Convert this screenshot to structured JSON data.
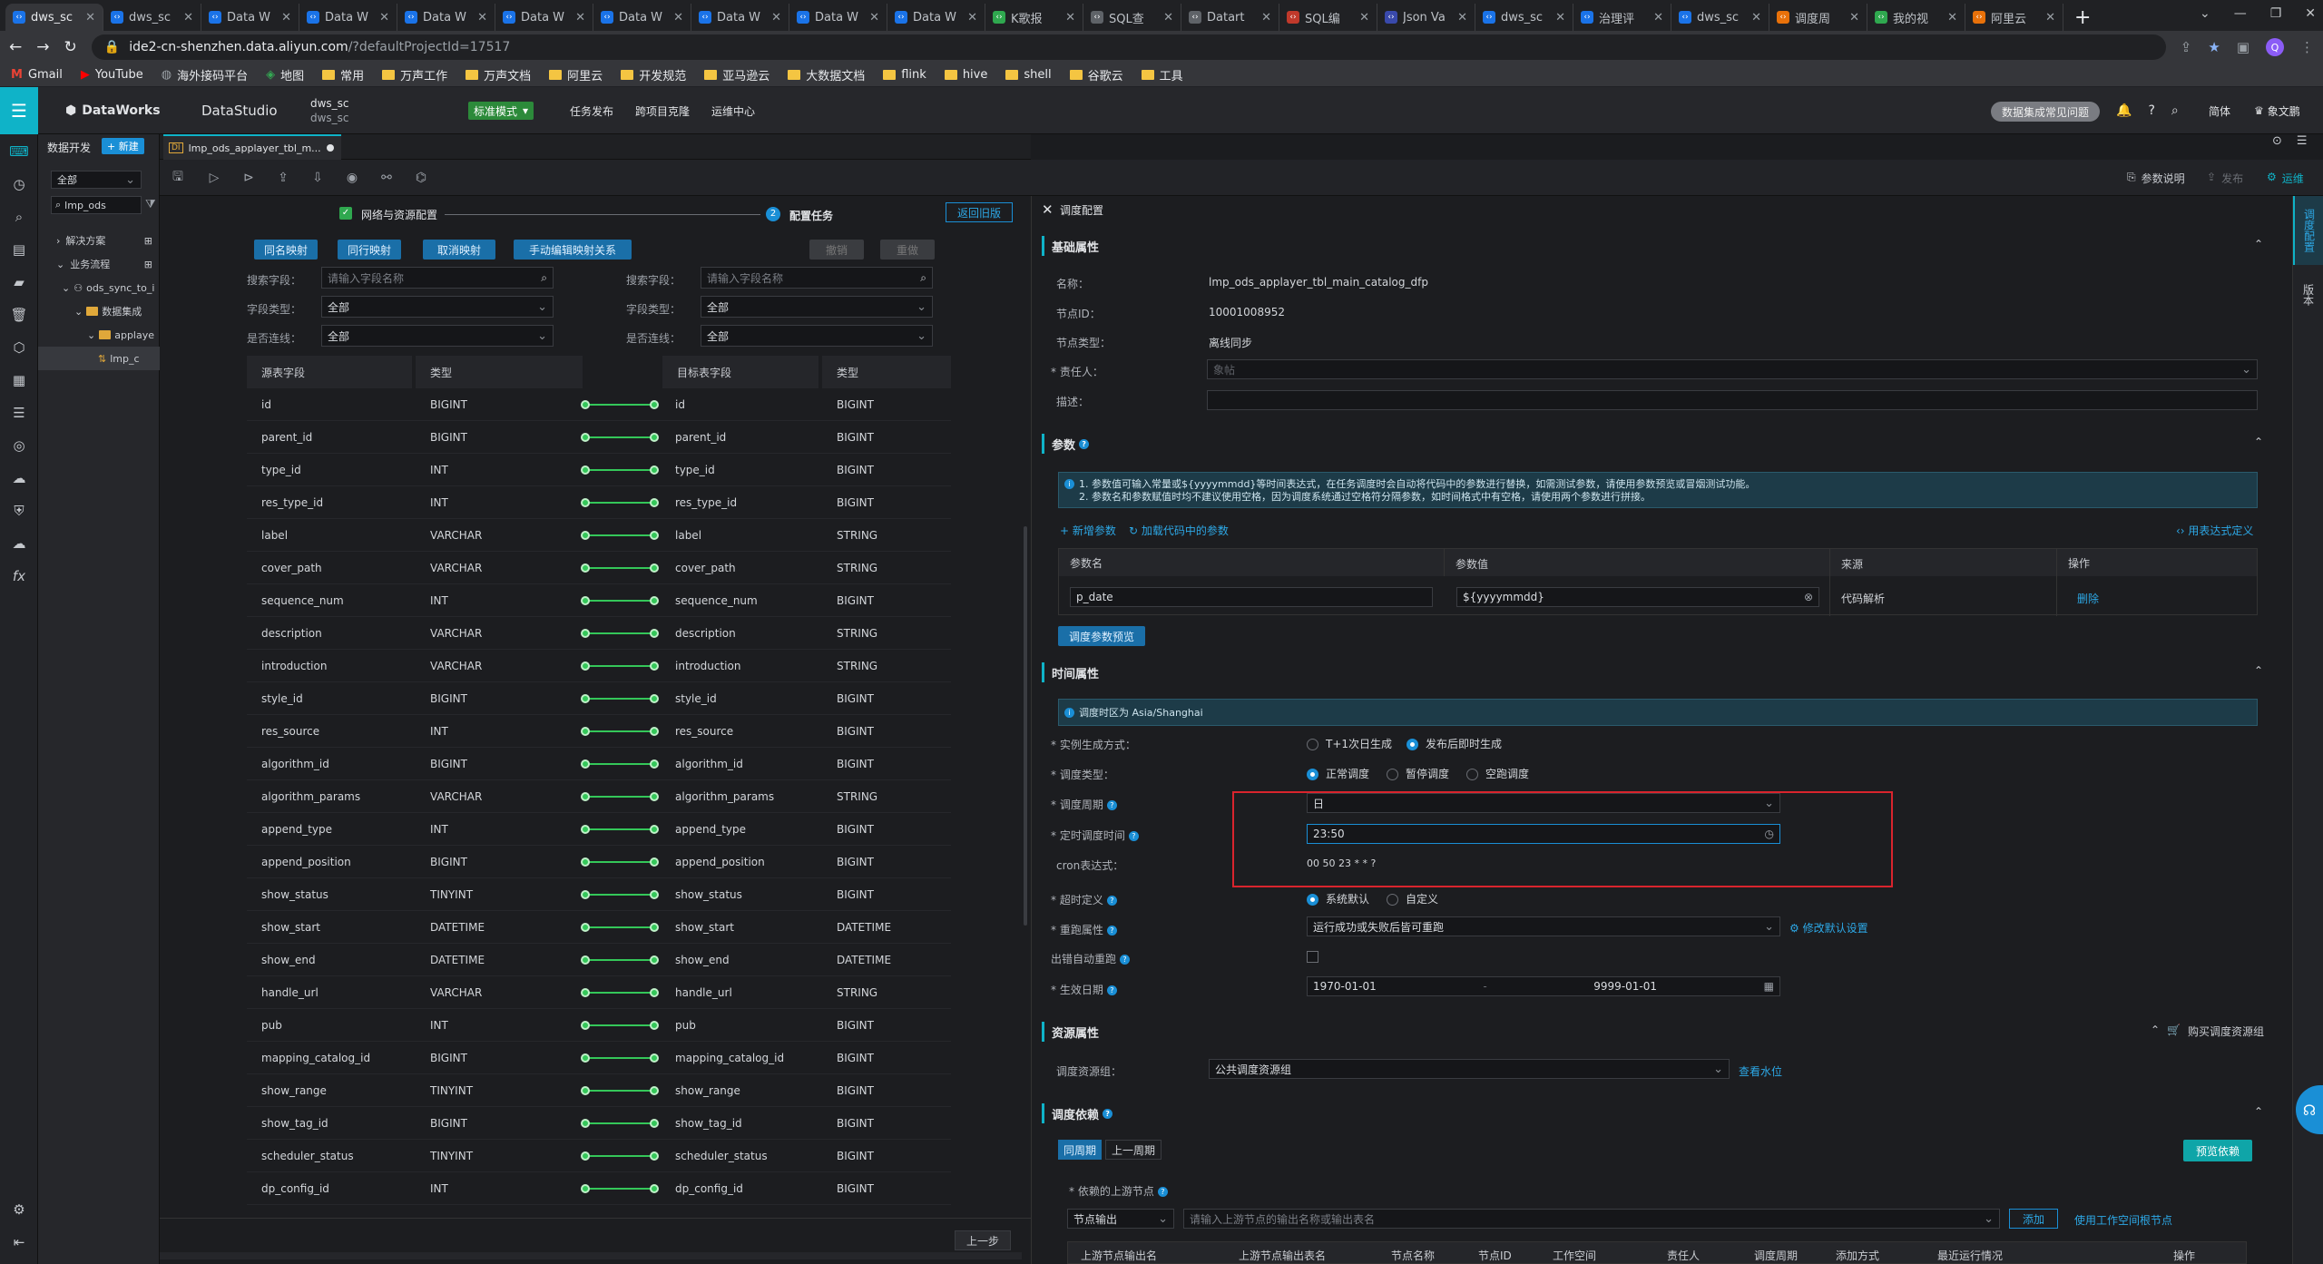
{
  "browser": {
    "tabs": [
      {
        "title": "dws_sc",
        "icon": "code-icon",
        "color": "#1a73e8"
      },
      {
        "title": "dws_sc",
        "icon": "code-icon",
        "color": "#1a73e8"
      },
      {
        "title": "Data W",
        "icon": "code-icon",
        "color": "#1a73e8"
      },
      {
        "title": "Data W",
        "icon": "code-icon",
        "color": "#1a73e8"
      },
      {
        "title": "Data W",
        "icon": "code-icon",
        "color": "#1a73e8"
      },
      {
        "title": "Data W",
        "icon": "code-icon",
        "color": "#1a73e8"
      },
      {
        "title": "Data W",
        "icon": "code-icon",
        "color": "#1a73e8"
      },
      {
        "title": "Data W",
        "icon": "code-icon",
        "color": "#1a73e8"
      },
      {
        "title": "Data W",
        "icon": "code-icon",
        "color": "#1a73e8"
      },
      {
        "title": "Data W",
        "icon": "code-icon",
        "color": "#1a73e8"
      },
      {
        "title": "K歌报",
        "icon": "k-icon",
        "color": "#2fa84f"
      },
      {
        "title": "SQL查",
        "icon": "search-icon",
        "color": "#5f6368"
      },
      {
        "title": "Datart",
        "icon": "datart-icon",
        "color": "#5f6368"
      },
      {
        "title": "SQL编",
        "icon": "sql-icon",
        "color": "#c0392b"
      },
      {
        "title": "Json Va",
        "icon": "json-icon",
        "color": "#3949ab"
      },
      {
        "title": "dws_sc",
        "icon": "code-icon",
        "color": "#1a73e8"
      },
      {
        "title": "治理评",
        "icon": "governance-icon",
        "color": "#1a73e8"
      },
      {
        "title": "dws_sc",
        "icon": "code-icon",
        "color": "#1a73e8"
      },
      {
        "title": "调度周",
        "icon": "schedule-icon",
        "color": "#e8710a"
      },
      {
        "title": "我的视",
        "icon": "video-icon",
        "color": "#2fa84f"
      },
      {
        "title": "阿里云",
        "icon": "aliyun-icon",
        "color": "#e8710a"
      }
    ],
    "url_host": "ide2-cn-shenzhen.data.aliyun.com",
    "url_path": "/?defaultProjectId=17517",
    "bookmarks": [
      "Gmail",
      "YouTube",
      "海外接码平台",
      "地图",
      "常用",
      "万声工作",
      "万声文档",
      "阿里云",
      "开发规范",
      "亚马逊云",
      "大数据文档",
      "flink",
      "hive",
      "shell",
      "谷歌云",
      "工具"
    ]
  },
  "header": {
    "brand": "DataWorks",
    "module": "DataStudio",
    "workspace": "dws_sc",
    "workspace_sub": "dws_sc",
    "mode": "标准模式",
    "nav": [
      "任务发布",
      "跨项目克隆",
      "运维中心"
    ],
    "faq": "数据集成常见问题",
    "lang": "简体",
    "user": "象文鹏"
  },
  "tree": {
    "title": "数据开发",
    "new": "+ 新建",
    "filter": "全部",
    "search_value": "lmp_ods",
    "items": [
      "解决方案",
      "业务流程",
      "ods_sync_to_i",
      "数据集成",
      "applaye",
      "lmp_c"
    ]
  },
  "editor": {
    "tab": "lmp_ods_applayer_tbl_m...",
    "step1": "网络与资源配置",
    "step2": "配置任务",
    "back_old": "返回旧版",
    "map_buttons": [
      "同名映射",
      "同行映射",
      "取消映射",
      "手动编辑映射关系"
    ],
    "undo": "撤销",
    "redo": "重做",
    "search_label": "搜索字段：",
    "search_ph": "请输入字段名称",
    "type_label": "字段类型：",
    "conn_label": "是否连线：",
    "all": "全部",
    "col_src": "源表字段",
    "col_type": "类型",
    "col_tgt": "目标表字段",
    "col_type2": "类型",
    "prev": "上一步",
    "rows": [
      [
        "id",
        "BIGINT",
        "id",
        "BIGINT"
      ],
      [
        "parent_id",
        "BIGINT",
        "parent_id",
        "BIGINT"
      ],
      [
        "type_id",
        "INT",
        "type_id",
        "BIGINT"
      ],
      [
        "res_type_id",
        "INT",
        "res_type_id",
        "BIGINT"
      ],
      [
        "label",
        "VARCHAR",
        "label",
        "STRING"
      ],
      [
        "cover_path",
        "VARCHAR",
        "cover_path",
        "STRING"
      ],
      [
        "sequence_num",
        "INT",
        "sequence_num",
        "BIGINT"
      ],
      [
        "description",
        "VARCHAR",
        "description",
        "STRING"
      ],
      [
        "introduction",
        "VARCHAR",
        "introduction",
        "STRING"
      ],
      [
        "style_id",
        "BIGINT",
        "style_id",
        "BIGINT"
      ],
      [
        "res_source",
        "INT",
        "res_source",
        "BIGINT"
      ],
      [
        "algorithm_id",
        "BIGINT",
        "algorithm_id",
        "BIGINT"
      ],
      [
        "algorithm_params",
        "VARCHAR",
        "algorithm_params",
        "STRING"
      ],
      [
        "append_type",
        "INT",
        "append_type",
        "BIGINT"
      ],
      [
        "append_position",
        "BIGINT",
        "append_position",
        "BIGINT"
      ],
      [
        "show_status",
        "TINYINT",
        "show_status",
        "BIGINT"
      ],
      [
        "show_start",
        "DATETIME",
        "show_start",
        "DATETIME"
      ],
      [
        "show_end",
        "DATETIME",
        "show_end",
        "DATETIME"
      ],
      [
        "handle_url",
        "VARCHAR",
        "handle_url",
        "STRING"
      ],
      [
        "pub",
        "INT",
        "pub",
        "BIGINT"
      ],
      [
        "mapping_catalog_id",
        "BIGINT",
        "mapping_catalog_id",
        "BIGINT"
      ],
      [
        "show_range",
        "TINYINT",
        "show_range",
        "BIGINT"
      ],
      [
        "show_tag_id",
        "BIGINT",
        "show_tag_id",
        "BIGINT"
      ],
      [
        "scheduler_status",
        "TINYINT",
        "scheduler_status",
        "BIGINT"
      ],
      [
        "dp_config_id",
        "INT",
        "dp_config_id",
        "BIGINT"
      ]
    ]
  },
  "toolbar_right": {
    "param_help": "参数说明",
    "publish": "发布",
    "ops": "运维"
  },
  "schedule": {
    "title": "调度配置",
    "basic": "基础属性",
    "name_l": "名称：",
    "name_v": "lmp_ods_applayer_tbl_main_catalog_dfp",
    "id_l": "节点ID：",
    "id_v": "10001008952",
    "type_l": "节点类型：",
    "type_v": "离线同步",
    "owner_l": "* 责任人：",
    "owner_v": "象帖",
    "desc_l": "描述：",
    "params": "参数",
    "info1": "1. 参数值可输入常量或${yyyymmdd}等时间表达式，在任务调度时会自动将代码中的参数进行替换，如需测试参数，请使用参数预览或冒烟测试功能。",
    "info2": "2. 参数名和参数赋值时均不建议使用空格，因为调度系统通过空格符分隔参数，如时间格式中有空格，请使用两个参数进行拼接。",
    "add_param": "+ 新增参数",
    "load_param": "加载代码中的参数",
    "expr_def": "用表达式定义",
    "pcol": [
      "参数名",
      "参数值",
      "来源",
      "操作"
    ],
    "p_name": "p_date",
    "p_value": "${yyyymmdd}",
    "p_src": "代码解析",
    "p_del": "删除",
    "preview": "调度参数预览",
    "time": "时间属性",
    "tz": "调度时区为 Asia/Shanghai",
    "inst_l": "* 实例生成方式：",
    "inst_a": "T+1次日生成",
    "inst_b": "发布后即时生成",
    "stype_l": "* 调度类型：",
    "stype_a": "正常调度",
    "stype_b": "暂停调度",
    "stype_c": "空跑调度",
    "period_l": "* 调度周期",
    "period_v": "日",
    "time_l": "* 定时调度时间",
    "time_v": "23:50",
    "cron_l": "cron表达式：",
    "cron_v": "00 50 23 * * ?",
    "timeout_l": "* 超时定义",
    "timeout_a": "系统默认",
    "timeout_b": "自定义",
    "rerun_l": "* 重跑属性",
    "rerun_v": "运行成功或失败后皆可重跑",
    "rerun_link": "修改默认设置",
    "auto_l": "出错自动重跑",
    "eff_l": "* 生效日期",
    "eff_start": "1970-01-01",
    "eff_end": "9999-01-01",
    "res": "资源属性",
    "buy_res": "购买调度资源组",
    "resgrp_l": "调度资源组：",
    "resgrp_v": "公共调度资源组",
    "water": "查看水位",
    "dep": "调度依赖",
    "dep_tab1": "同周期",
    "dep_tab2": "上一周期",
    "dep_preview": "预览依赖",
    "up_l": "* 依赖的上游节点",
    "up_sel": "节点输出",
    "up_ph": "请输入上游节点的输出名称或输出表名",
    "add": "添加",
    "use_root": "使用工作空间根节点",
    "dcols": [
      "上游节点输出名",
      "上游节点输出表名",
      "节点名称",
      "节点ID",
      "工作空间",
      "责任人",
      "调度周期",
      "添加方式",
      "最近运行情况",
      "操作"
    ]
  },
  "side": {
    "sched_cfg": "调度配置",
    "version": "版本"
  }
}
